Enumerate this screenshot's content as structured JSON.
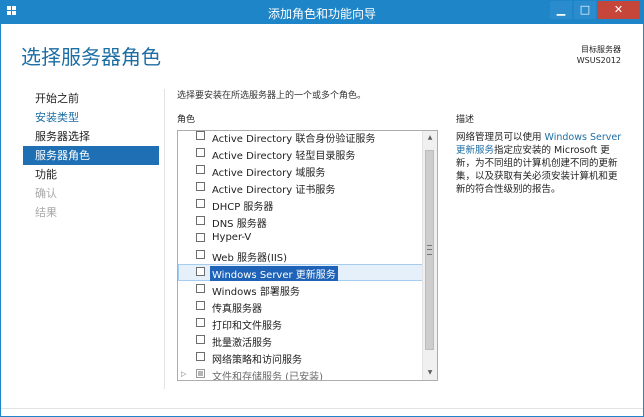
{
  "window": {
    "title": "添加角色和功能向导",
    "controls": {
      "minimize": "▁",
      "maximize": "□",
      "close": "✕"
    }
  },
  "page_title": "选择服务器角色",
  "target_server": {
    "label": "目标服务器",
    "name": "WSUS2012"
  },
  "nav": [
    {
      "label": "开始之前",
      "state": "normal"
    },
    {
      "label": "安装类型",
      "state": "link"
    },
    {
      "label": "服务器选择",
      "state": "normal"
    },
    {
      "label": "服务器角色",
      "state": "active"
    },
    {
      "label": "功能",
      "state": "normal"
    },
    {
      "label": "确认",
      "state": "disabled"
    },
    {
      "label": "结果",
      "state": "disabled"
    }
  ],
  "instruction": "选择要安装在所选服务器上的一个或多个角色。",
  "roles_header": "角色",
  "description_header": "描述",
  "roles": [
    {
      "label": "Active Directory 联合身份验证服务",
      "checked": false,
      "selected": false
    },
    {
      "label": "Active Directory 轻型目录服务",
      "checked": false,
      "selected": false
    },
    {
      "label": "Active Directory 域服务",
      "checked": false,
      "selected": false
    },
    {
      "label": "Active Directory 证书服务",
      "checked": false,
      "selected": false
    },
    {
      "label": "DHCP 服务器",
      "checked": false,
      "selected": false
    },
    {
      "label": "DNS 服务器",
      "checked": false,
      "selected": false
    },
    {
      "label": "Hyper-V",
      "checked": false,
      "selected": false
    },
    {
      "label": "Web 服务器(IIS)",
      "checked": false,
      "selected": false
    },
    {
      "label": "Windows Server 更新服务",
      "checked": false,
      "selected": true
    },
    {
      "label": "Windows 部署服务",
      "checked": false,
      "selected": false
    },
    {
      "label": "传真服务器",
      "checked": false,
      "selected": false
    },
    {
      "label": "打印和文件服务",
      "checked": false,
      "selected": false
    },
    {
      "label": "批量激活服务",
      "checked": false,
      "selected": false
    },
    {
      "label": "网络策略和访问服务",
      "checked": false,
      "selected": false
    },
    {
      "label": "文件和存储服务 (已安装)",
      "checked": false,
      "selected": false,
      "expandable": true
    }
  ],
  "description": {
    "prefix": "网络管理员可以使用 ",
    "highlight": "Windows Server 更新服务",
    "suffix": "指定应安装的 Microsoft 更新，为不同组的计算机创建不同的更新集，以及获取有关必须安装计算机和更新的符合性级别的报告。"
  },
  "colors": {
    "accent": "#1e85c8",
    "heading": "#1c6ea4",
    "nav_active": "#1e6fb3",
    "close": "#c7463a"
  }
}
